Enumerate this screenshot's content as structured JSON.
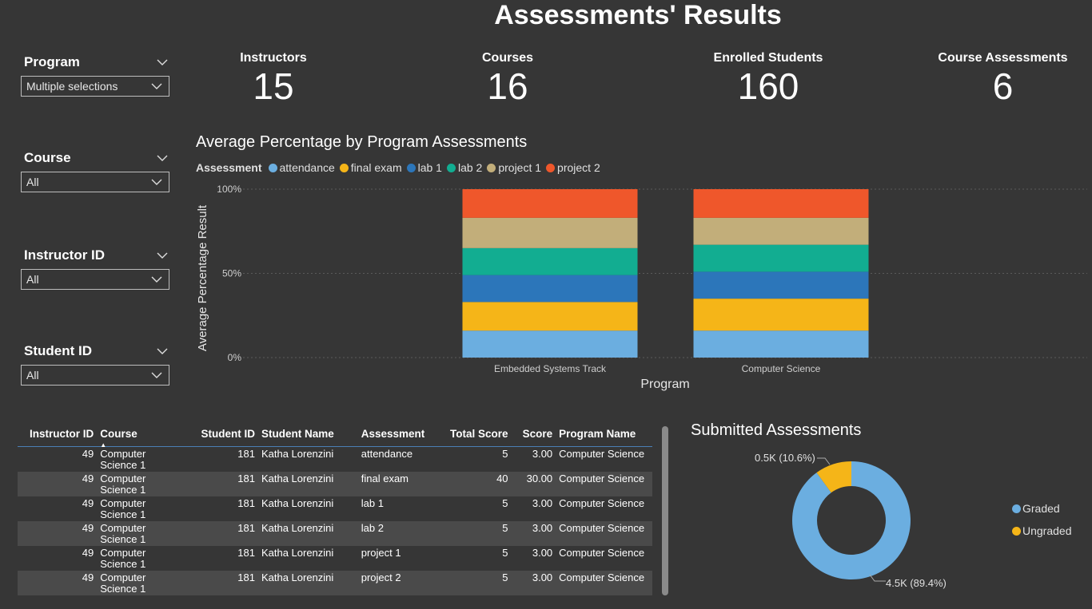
{
  "title": "Assessments' Results",
  "slicers": [
    {
      "title": "Program",
      "value": "Multiple selections"
    },
    {
      "title": "Course",
      "value": "All"
    },
    {
      "title": "Instructor ID",
      "value": "All"
    },
    {
      "title": "Student ID",
      "value": "All"
    }
  ],
  "kpis": [
    {
      "label": "Instructors",
      "value": "15"
    },
    {
      "label": "Courses",
      "value": "16"
    },
    {
      "label": "Enrolled Students",
      "value": "160"
    },
    {
      "label": "Course Assessments",
      "value": "6"
    }
  ],
  "chart_data": [
    {
      "type": "bar",
      "stacked": true,
      "title": "Average Percentage by Program Assessments",
      "legend_title": "Assessment",
      "legend_position": "top-left",
      "xlabel": "Program",
      "ylabel": "Average Percentage Result",
      "ylim": [
        0,
        100
      ],
      "yticks": [
        "0%",
        "50%",
        "100%"
      ],
      "grid": true,
      "categories": [
        "Embedded Systems Track",
        "Computer Science"
      ],
      "series": [
        {
          "name": "attendance",
          "color": "#6baee0",
          "values": [
            16,
            16
          ]
        },
        {
          "name": "final exam",
          "color": "#f5b518",
          "values": [
            17,
            19
          ]
        },
        {
          "name": "lab 1",
          "color": "#2c76ba",
          "values": [
            16,
            16
          ]
        },
        {
          "name": "lab 2",
          "color": "#12ad91",
          "values": [
            16,
            16
          ]
        },
        {
          "name": "project 1",
          "color": "#c2ae7a",
          "values": [
            18,
            16
          ]
        },
        {
          "name": "project 2",
          "color": "#ef572b",
          "values": [
            17,
            17
          ]
        }
      ]
    },
    {
      "type": "pie",
      "donut": true,
      "title": "Submitted Assessments",
      "legend_position": "right",
      "labels": [
        "Graded",
        "Ungraded"
      ],
      "values": [
        4500,
        500
      ],
      "percents": [
        89.4,
        10.6
      ],
      "colors": [
        "#6baee0",
        "#f5b518"
      ],
      "data_labels": [
        "4.5K (89.4%)",
        "0.5K (10.6%)"
      ]
    }
  ],
  "table": {
    "columns": [
      "Instructor ID",
      "Course",
      "Student ID",
      "Student Name",
      "Assessment",
      "Total Score",
      "Score",
      "Program Name"
    ],
    "rows": [
      [
        "49",
        "Computer Science 1",
        "181",
        "Katha Lorenzini",
        "attendance",
        "5",
        "3.00",
        "Computer Science"
      ],
      [
        "49",
        "Computer Science 1",
        "181",
        "Katha Lorenzini",
        "final exam",
        "40",
        "30.00",
        "Computer Science"
      ],
      [
        "49",
        "Computer Science 1",
        "181",
        "Katha Lorenzini",
        "lab 1",
        "5",
        "3.00",
        "Computer Science"
      ],
      [
        "49",
        "Computer Science 1",
        "181",
        "Katha Lorenzini",
        "lab 2",
        "5",
        "3.00",
        "Computer Science"
      ],
      [
        "49",
        "Computer Science 1",
        "181",
        "Katha Lorenzini",
        "project 1",
        "5",
        "3.00",
        "Computer Science"
      ],
      [
        "49",
        "Computer Science 1",
        "181",
        "Katha Lorenzini",
        "project 2",
        "5",
        "3.00",
        "Computer Science"
      ]
    ]
  }
}
